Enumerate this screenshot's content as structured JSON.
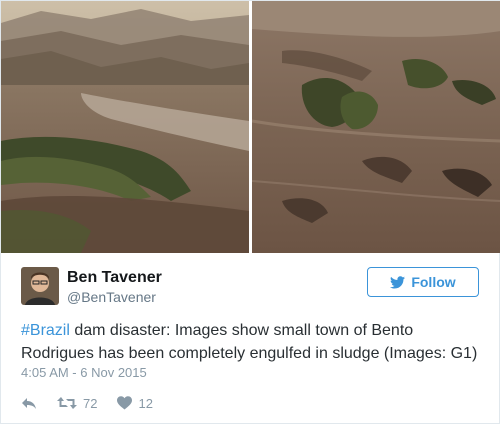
{
  "tweet": {
    "display_name": "Ben Tavener",
    "handle": "@BenTavener",
    "follow_label": "Follow",
    "text_hashtag": "#Brazil",
    "text_body": " dam disaster: Images show small town of Bento Rodrigues has been completely engulfed in sludge (Images: G1)",
    "timestamp": "4:05 AM - 6 Nov 2015",
    "retweet_count": "72",
    "like_count": "12"
  },
  "colors": {
    "twitter_blue": "#3b94d9",
    "muted_text": "#8899a6",
    "mud_brown": "#7a6150"
  },
  "icons": {
    "follow": "bird-icon",
    "reply": "reply-icon",
    "retweet": "retweet-icon",
    "like": "heart-icon"
  }
}
